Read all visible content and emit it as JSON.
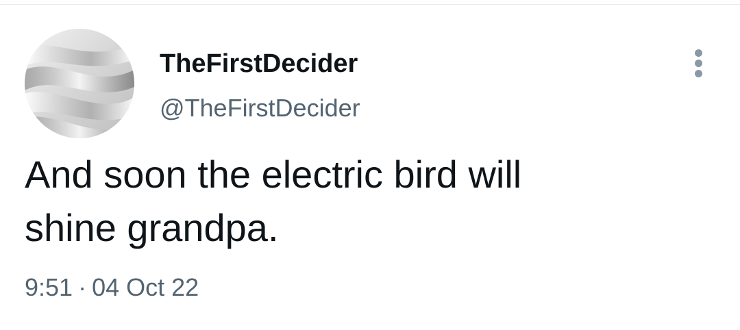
{
  "tweet": {
    "author": {
      "display_name": "TheFirstDecider",
      "handle": "@TheFirstDecider",
      "avatar_icon": "silk-fabric-avatar-icon"
    },
    "text_lines": [
      "And soon the electric bird will",
      "shine grandpa."
    ],
    "time": "9:51",
    "separator": "·",
    "date": "04 Oct 22",
    "more_icon": "more-vertical-icon"
  },
  "colors": {
    "primary_text": "#0f1419",
    "secondary_text": "#536471",
    "icon_gray": "#8b98a5",
    "divider": "#e6ecf0",
    "background": "#ffffff"
  }
}
